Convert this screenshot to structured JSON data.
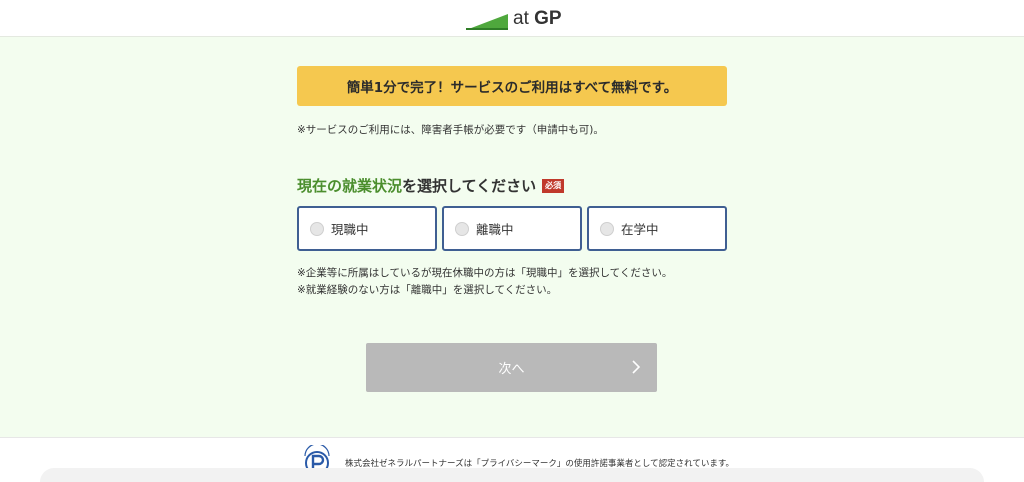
{
  "header": {
    "logo": {
      "at": "at",
      "gp": "GP",
      "brand_color": "#4fa83d"
    }
  },
  "banner": {
    "text": "簡単1分で完了！サービスのご利用はすべて無料です。",
    "color": "#f5c84f"
  },
  "note_top": "※サービスのご利用には、障害者手帳が必要です（申請中も可)。",
  "question": {
    "highlight": "現在の就業状況",
    "rest": "を選択してください",
    "required_badge": "必須"
  },
  "options": [
    {
      "label": "現職中",
      "selected": false
    },
    {
      "label": "離職中",
      "selected": false
    },
    {
      "label": "在学中",
      "selected": false
    }
  ],
  "notes": [
    "※企業等に所属はしているが現在休職中の方は「現職中」を選択してください。",
    "※就業経験のない方は「離職中」を選択してください。"
  ],
  "next_button": {
    "label": "次へ",
    "icon": "chevron-right-icon",
    "enabled": false
  },
  "footer": {
    "text": "株式会社ゼネラルパートナーズは「プライバシーマーク」の使用許諾事業者として認定されています。",
    "mark_icon": "privacy-mark-icon"
  }
}
